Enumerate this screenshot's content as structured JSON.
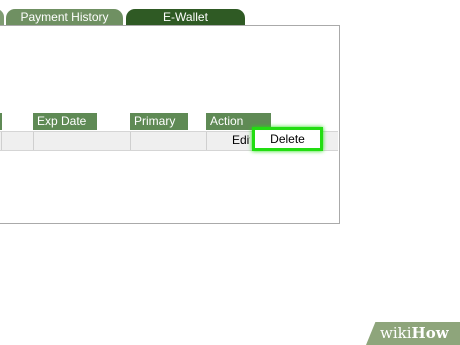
{
  "tabs": {
    "partial_label": "",
    "payment_history": "Payment History",
    "ewallet": "E-Wallet"
  },
  "table": {
    "headers": {
      "exp_date": "Exp Date",
      "primary": "Primary",
      "action": "Action"
    },
    "row": {
      "edit_label": "Edit",
      "delete_label": "Delete"
    }
  },
  "watermark": {
    "wiki": "wiki",
    "how": "How"
  },
  "colors": {
    "tab_dark": "#2f5a24",
    "tab_light": "#6f9062",
    "header_green": "#5f8a55",
    "highlight": "#22dd11"
  }
}
